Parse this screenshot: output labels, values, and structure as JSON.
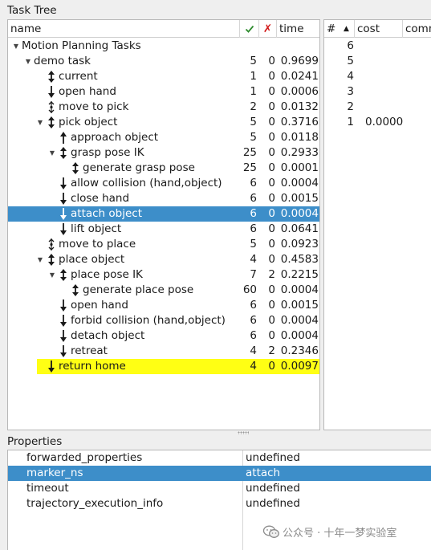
{
  "task_tree": {
    "title": "Task Tree",
    "columns": {
      "name": "name",
      "ok": "✓",
      "fail": "✗",
      "time": "time"
    },
    "rows": [
      {
        "name": "Motion Planning Tasks",
        "depth": 0,
        "arrow": "down",
        "icon": "none",
        "ok": "",
        "fail": "",
        "time": ""
      },
      {
        "name": "demo task",
        "depth": 1,
        "arrow": "down",
        "icon": "none",
        "ok": "5",
        "fail": "0",
        "time": "0.9699"
      },
      {
        "name": "current",
        "depth": 2,
        "arrow": "none",
        "icon": "bidirectional-arrow-icon",
        "ok": "1",
        "fail": "0",
        "time": "0.0241"
      },
      {
        "name": "open hand",
        "depth": 2,
        "arrow": "none",
        "icon": "down-arrow-icon",
        "ok": "1",
        "fail": "0",
        "time": "0.0006"
      },
      {
        "name": "move to pick",
        "depth": 2,
        "arrow": "none",
        "icon": "connect-icon",
        "ok": "2",
        "fail": "0",
        "time": "0.0132"
      },
      {
        "name": "pick object",
        "depth": 2,
        "arrow": "down",
        "icon": "bidirectional-arrow-icon",
        "ok": "5",
        "fail": "0",
        "time": "0.3716"
      },
      {
        "name": "approach object",
        "depth": 3,
        "arrow": "none",
        "icon": "up-arrow-icon",
        "ok": "5",
        "fail": "0",
        "time": "0.0118"
      },
      {
        "name": "grasp pose IK",
        "depth": 3,
        "arrow": "down",
        "icon": "bidirectional-arrow-icon",
        "ok": "25",
        "fail": "0",
        "time": "0.2933"
      },
      {
        "name": "generate grasp pose",
        "depth": 4,
        "arrow": "none",
        "icon": "bidirectional-arrow-icon",
        "ok": "25",
        "fail": "0",
        "time": "0.0001"
      },
      {
        "name": "allow collision (hand,object)",
        "depth": 3,
        "arrow": "none",
        "icon": "down-arrow-icon",
        "ok": "6",
        "fail": "0",
        "time": "0.0004"
      },
      {
        "name": "close hand",
        "depth": 3,
        "arrow": "none",
        "icon": "down-arrow-icon",
        "ok": "6",
        "fail": "0",
        "time": "0.0015"
      },
      {
        "name": "attach object",
        "depth": 3,
        "arrow": "none",
        "icon": "down-arrow-icon",
        "ok": "6",
        "fail": "0",
        "time": "0.0004",
        "selected": true
      },
      {
        "name": "lift object",
        "depth": 3,
        "arrow": "none",
        "icon": "down-arrow-icon",
        "ok": "6",
        "fail": "0",
        "time": "0.0641"
      },
      {
        "name": "move to place",
        "depth": 2,
        "arrow": "none",
        "icon": "connect-icon",
        "ok": "5",
        "fail": "0",
        "time": "0.0923"
      },
      {
        "name": "place object",
        "depth": 2,
        "arrow": "down",
        "icon": "bidirectional-arrow-icon",
        "ok": "4",
        "fail": "0",
        "time": "0.4583"
      },
      {
        "name": "place pose IK",
        "depth": 3,
        "arrow": "down",
        "icon": "bidirectional-arrow-icon",
        "ok": "7",
        "fail": "2",
        "time": "0.2215"
      },
      {
        "name": "generate place pose",
        "depth": 4,
        "arrow": "none",
        "icon": "bidirectional-arrow-icon",
        "ok": "60",
        "fail": "0",
        "time": "0.0004"
      },
      {
        "name": "open hand",
        "depth": 3,
        "arrow": "none",
        "icon": "down-arrow-icon",
        "ok": "6",
        "fail": "0",
        "time": "0.0015"
      },
      {
        "name": "forbid collision (hand,object)",
        "depth": 3,
        "arrow": "none",
        "icon": "down-arrow-icon",
        "ok": "6",
        "fail": "0",
        "time": "0.0004"
      },
      {
        "name": "detach object",
        "depth": 3,
        "arrow": "none",
        "icon": "down-arrow-icon",
        "ok": "6",
        "fail": "0",
        "time": "0.0004"
      },
      {
        "name": "retreat",
        "depth": 3,
        "arrow": "none",
        "icon": "down-arrow-icon",
        "ok": "4",
        "fail": "2",
        "time": "0.2346"
      },
      {
        "name": "return home",
        "depth": 2,
        "arrow": "none",
        "icon": "down-arrow-icon",
        "ok": "4",
        "fail": "0",
        "time": "0.0097",
        "highlighted": true
      }
    ]
  },
  "solutions": {
    "columns": {
      "index": "#",
      "cost": "cost",
      "comment": "comm"
    },
    "sort_indicator": "ascending",
    "rows": [
      {
        "index": "6",
        "cost": ""
      },
      {
        "index": "5",
        "cost": ""
      },
      {
        "index": "4",
        "cost": ""
      },
      {
        "index": "3",
        "cost": ""
      },
      {
        "index": "2",
        "cost": ""
      },
      {
        "index": "1",
        "cost": "0.0000"
      }
    ]
  },
  "properties": {
    "title": "Properties",
    "rows": [
      {
        "name": "forwarded_properties",
        "value": "undefined"
      },
      {
        "name": "marker_ns",
        "value": "attach",
        "selected": true
      },
      {
        "name": "timeout",
        "value": "undefined"
      },
      {
        "name": "trajectory_execution_info",
        "value": "undefined"
      }
    ]
  },
  "watermark": "公众号 · 十年一梦实验室",
  "colors": {
    "selection": "#3d8ec9",
    "highlight": "#ffff14",
    "check": "#2e8b2e",
    "cross": "#d21b1b"
  }
}
